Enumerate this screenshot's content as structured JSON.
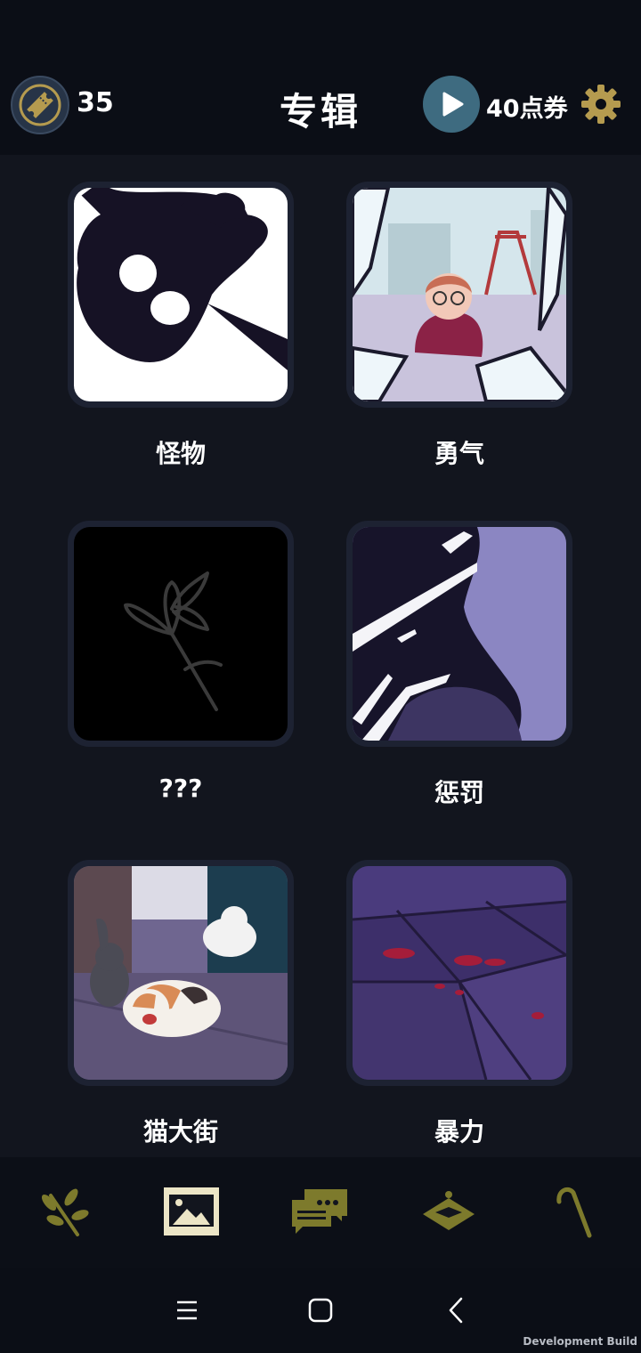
{
  "header": {
    "ticket_count": "35",
    "title": "专辑",
    "coupon_label": "40点券"
  },
  "albums": [
    {
      "name": "怪物",
      "icon": "monster-cover"
    },
    {
      "name": "勇气",
      "icon": "courage-cover"
    },
    {
      "name": "???",
      "icon": "locked-flower-cover"
    },
    {
      "name": "惩罚",
      "icon": "punishment-cover"
    },
    {
      "name": "猫大街",
      "icon": "cat-street-cover"
    },
    {
      "name": "暴力",
      "icon": "violence-cover"
    }
  ],
  "bottom_nav": [
    {
      "icon": "plant-sprig-icon",
      "active": false
    },
    {
      "icon": "gallery-icon",
      "active": true
    },
    {
      "icon": "chat-icon",
      "active": false
    },
    {
      "icon": "hat-icon",
      "active": false
    },
    {
      "icon": "cane-icon",
      "active": false
    }
  ],
  "system_nav": {
    "dev_build": "Development Build"
  },
  "colors": {
    "accent_gold": "#b59b4f",
    "nav_olive": "#7d7a2c",
    "background": "#12151e"
  }
}
